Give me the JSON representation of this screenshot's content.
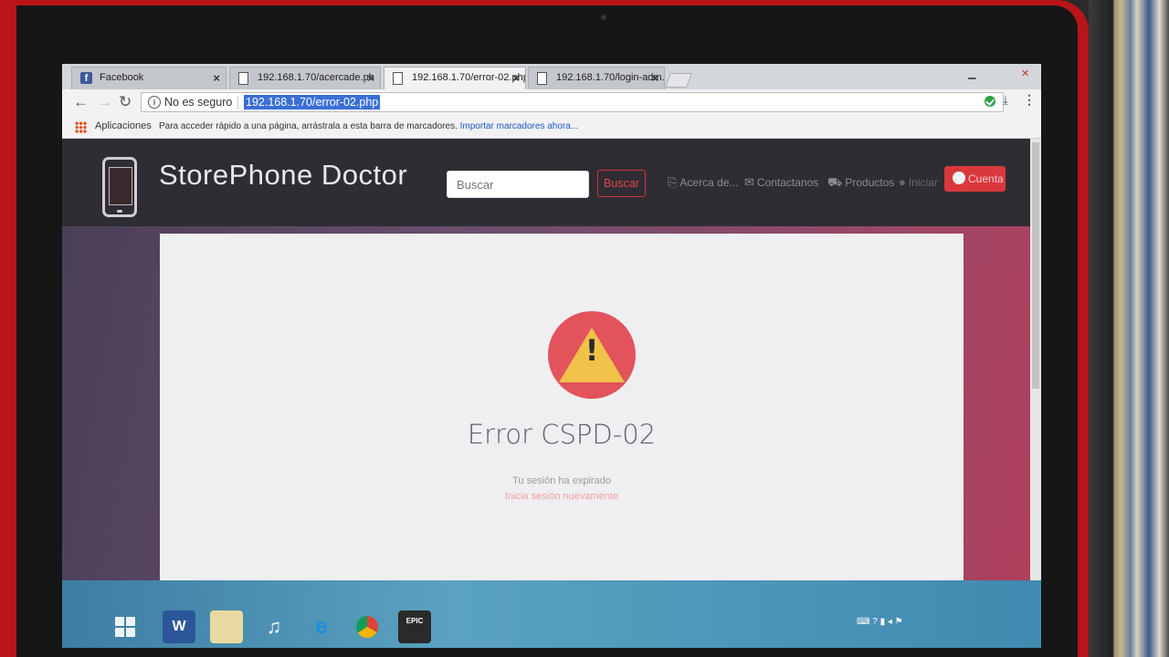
{
  "browser": {
    "tabs": [
      {
        "label": "Facebook",
        "icon": "facebook-icon",
        "active": false
      },
      {
        "label": "192.168.1.70/acercade.ph",
        "icon": "page-icon",
        "active": false
      },
      {
        "label": "192.168.1.70/error-02.php",
        "icon": "page-icon",
        "active": true
      },
      {
        "label": "192.168.1.70/login-adm.p",
        "icon": "page-icon",
        "active": false
      }
    ],
    "security_label": "No es seguro",
    "url": "192.168.1.70/error-02.php",
    "bookmarks": {
      "apps_label": "Aplicaciones",
      "hint_text": "Para acceder rápido a una página, arrástrala a esta barra de marcadores.",
      "import_link": "Importar marcadores ahora..."
    }
  },
  "site": {
    "brand": "StorePhone Doctor",
    "search_placeholder": "Buscar",
    "search_button": "Buscar",
    "nav": {
      "about": "Acerca de...",
      "contact": "Contactanos",
      "products": "Productos",
      "login": "Iniciar",
      "account": "Cuenta"
    },
    "accent_color": "#d9383d"
  },
  "error": {
    "icon": "warning-icon",
    "title": "Error CSPD-02",
    "message": "Tu sesión ha expirado",
    "action_link": "Inicia sesión nuevamente"
  }
}
